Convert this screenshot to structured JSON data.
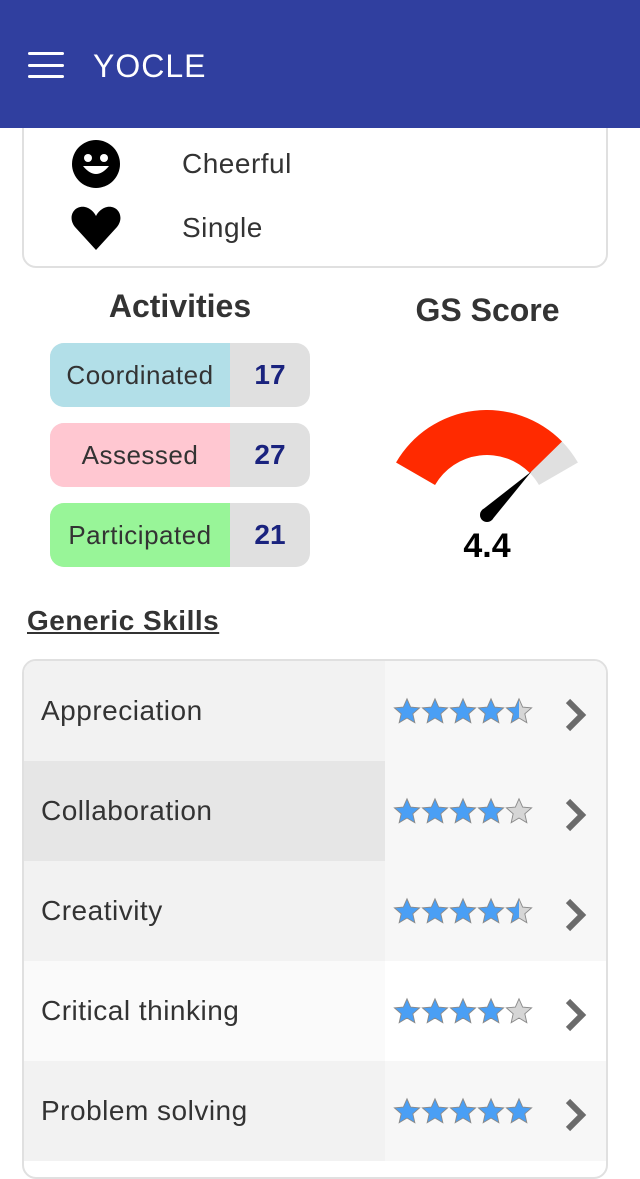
{
  "appbar": {
    "title": "YOCLE",
    "color": "#303f9f"
  },
  "profile": {
    "traits": [
      {
        "icon": "smiley-icon",
        "label": "Cheerful"
      },
      {
        "icon": "heart-icon",
        "label": "Single"
      }
    ]
  },
  "activities": {
    "title": "Activities",
    "items": [
      {
        "label": "Coordinated",
        "count": "17",
        "color": "#b2dfe8"
      },
      {
        "label": "Assessed",
        "count": "27",
        "color": "#ffc7d1"
      },
      {
        "label": "Participated",
        "count": "21",
        "color": "#98f598"
      }
    ]
  },
  "gs_score": {
    "title": "GS Score",
    "value": "4.4",
    "fill_color": "#ff2a00",
    "track_color": "#e0e0e0"
  },
  "generic_skills": {
    "title": "Generic Skills",
    "skills": [
      {
        "name": "Appreciation",
        "rating": 4.5
      },
      {
        "name": "Collaboration",
        "rating": 4
      },
      {
        "name": "Creativity",
        "rating": 4.5
      },
      {
        "name": "Critical thinking",
        "rating": 4
      },
      {
        "name": "Problem solving",
        "rating": 5
      }
    ],
    "star_color": "#4a9ff5",
    "empty_star_color": "#d6d6d6"
  }
}
